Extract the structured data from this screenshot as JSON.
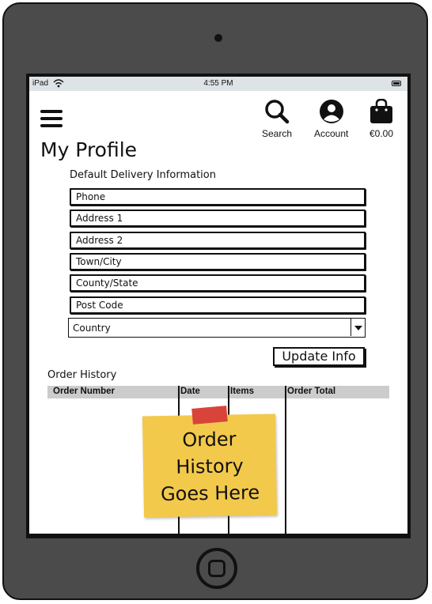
{
  "status_bar": {
    "carrier": "iPad",
    "time": "4:55 PM"
  },
  "header": {
    "search_label": "Search",
    "account_label": "Account",
    "cart_label": "€0.00"
  },
  "page": {
    "title": "My Profile"
  },
  "delivery": {
    "section_label": "Default Delivery Information",
    "fields": [
      "Phone",
      "Address 1",
      "Address 2",
      "Town/City",
      "County/State",
      "Post Code"
    ],
    "country_select": "Country",
    "update_button": "Update Info"
  },
  "order_history": {
    "section_label": "Order History",
    "columns": [
      "Order Number",
      "Date",
      "Items",
      "Order Total"
    ],
    "placeholder_lines": [
      "Order",
      "History",
      "Goes Here"
    ],
    "sticky_note_color": "#f3c94c",
    "tape_color": "#d9443a"
  },
  "colors": {
    "device_frame": "#4b4b4b",
    "status_bar": "#dde3e6",
    "table_header": "#cccccc"
  }
}
